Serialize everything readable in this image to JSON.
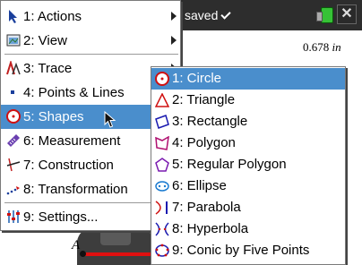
{
  "document": {
    "title": "saved",
    "measurement": {
      "value": "0.678",
      "unit": "in"
    },
    "point_label": "A"
  },
  "main_menu": {
    "items": [
      {
        "label": "1: Actions",
        "icon": "arrow-pointer-icon",
        "has_submenu": true
      },
      {
        "label": "2: View",
        "icon": "view-icon",
        "has_submenu": true
      },
      {
        "label": "3: Trace",
        "icon": "trace-icon",
        "has_submenu": true
      },
      {
        "label": "4: Points & Lines",
        "icon": "points-lines-icon",
        "has_submenu": true
      },
      {
        "label": "5: Shapes",
        "icon": "shapes-icon",
        "has_submenu": true,
        "selected": true
      },
      {
        "label": "6: Measurement",
        "icon": "measurement-icon",
        "has_submenu": true
      },
      {
        "label": "7: Construction",
        "icon": "construction-icon",
        "has_submenu": true
      },
      {
        "label": "8: Transformation",
        "icon": "transformation-icon",
        "has_submenu": true
      },
      {
        "label": "9: Settings...",
        "icon": "settings-icon",
        "has_submenu": false
      }
    ]
  },
  "shapes_submenu": {
    "items": [
      {
        "label": "1: Circle",
        "icon": "circle-icon",
        "selected": true
      },
      {
        "label": "2: Triangle",
        "icon": "triangle-icon"
      },
      {
        "label": "3: Rectangle",
        "icon": "rectangle-icon"
      },
      {
        "label": "4: Polygon",
        "icon": "polygon-icon"
      },
      {
        "label": "5: Regular Polygon",
        "icon": "regular-polygon-icon"
      },
      {
        "label": "6: Ellipse",
        "icon": "ellipse-icon"
      },
      {
        "label": "7: Parabola",
        "icon": "parabola-icon"
      },
      {
        "label": "8: Hyperbola",
        "icon": "hyperbola-icon"
      },
      {
        "label": "9: Conic by Five Points",
        "icon": "conic-icon"
      }
    ]
  },
  "colors": {
    "selection": "#4a8ecc",
    "menu_border": "#7a7a7a",
    "topbar": "#2d2d2d"
  }
}
